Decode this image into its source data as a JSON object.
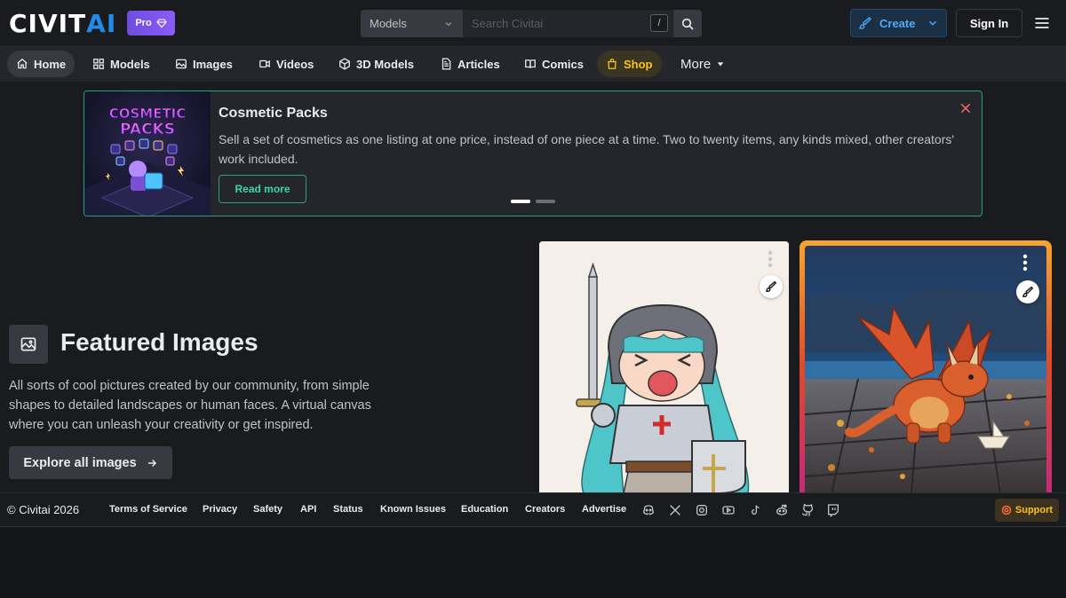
{
  "header": {
    "logo_main": "CIVIT",
    "logo_accent": "AI",
    "pro_label": "Pro",
    "search_category": "Models",
    "search_placeholder": "Search Civitai",
    "search_shortcut": "/",
    "create_label": "Create",
    "signin_label": "Sign In",
    "accent_color": "#228be6"
  },
  "nav": {
    "items": [
      {
        "label": "Home",
        "icon": "home-icon"
      },
      {
        "label": "Models",
        "icon": "grid-icon"
      },
      {
        "label": "Images",
        "icon": "photo-icon"
      },
      {
        "label": "Videos",
        "icon": "video-icon"
      },
      {
        "label": "3D Models",
        "icon": "cube-icon"
      },
      {
        "label": "Articles",
        "icon": "article-icon"
      },
      {
        "label": "Comics",
        "icon": "book-icon"
      },
      {
        "label": "Shop",
        "icon": "shopping-bag-icon"
      }
    ],
    "more_label": "More"
  },
  "banner": {
    "title": "Cosmetic Packs",
    "description": "Sell a set of cosmetics as one listing at one price, instead of one piece at a time. Two to twenty items, any kinds mixed, other creators' work included.",
    "button_label": "Read more",
    "image_text_1": "COSMETIC",
    "image_text_2": "PACKS",
    "border_color": "#2f9e7a"
  },
  "featured": {
    "title": "Featured Images",
    "description": "All sorts of cool pictures created by our community, from simple shapes to detailed landscapes or human faces. A virtual canvas where you can unleash your creativity or get inspired.",
    "button_label": "Explore all images"
  },
  "footer": {
    "copyright": "© Civitai 2026",
    "links": [
      "Terms of Service",
      "Privacy",
      "Safety",
      "API",
      "Status",
      "Known Issues",
      "Education",
      "Creators",
      "Advertise"
    ],
    "social_icons": [
      "discord-icon",
      "x-icon",
      "instagram-icon",
      "youtube-icon",
      "tiktok-icon",
      "reddit-icon",
      "github-icon",
      "twitch-icon"
    ],
    "support_label": "Support"
  }
}
